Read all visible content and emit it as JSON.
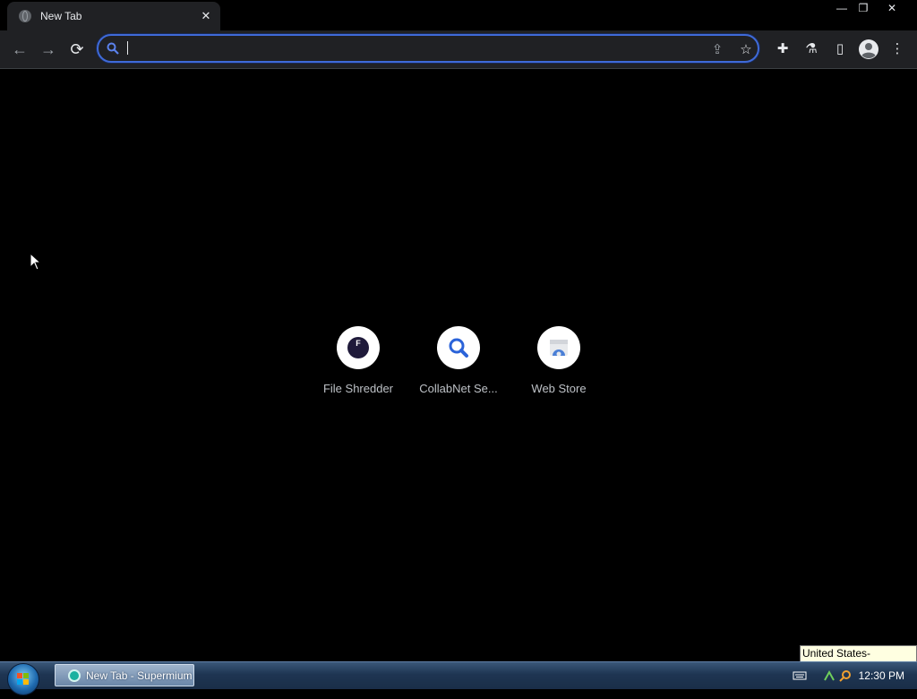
{
  "tab": {
    "title": "New Tab",
    "close_glyph": "✕"
  },
  "window_controls": {
    "minimize": "—",
    "restore": "❐",
    "close": "✕"
  },
  "toolbar": {
    "back_glyph": "←",
    "forward_glyph": "→",
    "reload_glyph": "⟳",
    "omnibox": {
      "value": "",
      "placeholder": ""
    },
    "share_glyph": "⇪",
    "bookmark_glyph": "☆",
    "extensions_glyph": "✚",
    "labs_glyph": "⚗",
    "sidepanel_glyph": "▯",
    "menu_glyph": "⋮"
  },
  "shortcuts": [
    {
      "label": "File Shredder",
      "icon": "file-shredder-icon"
    },
    {
      "label": "CollabNet Se...",
      "icon": "magnifier-icon"
    },
    {
      "label": "Web Store",
      "icon": "web-store-icon"
    }
  ],
  "taskbar": {
    "task_label": "New Tab - Supermium",
    "clock": "12:30 PM",
    "tooltip": "United States-International"
  },
  "colors": {
    "accent": "#3f6ad8",
    "background": "#000000",
    "toolbar": "#202124"
  }
}
